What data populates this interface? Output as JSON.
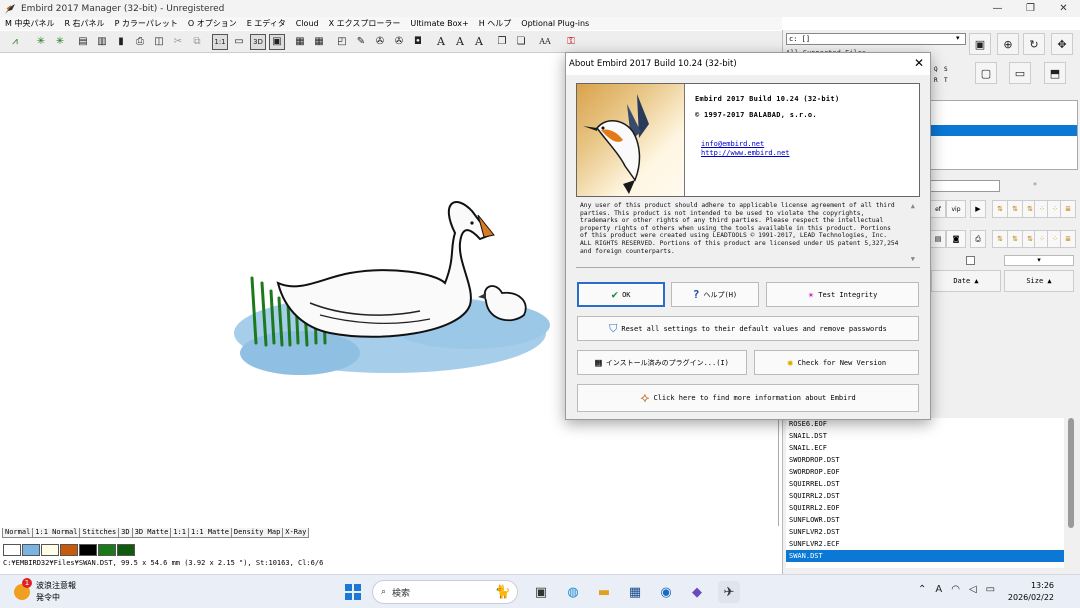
{
  "window": {
    "title": "Embird 2017 Manager (32-bit) - Unregistered",
    "controls": [
      "—",
      "❐",
      "✕"
    ]
  },
  "menu": [
    "M 中央パネル",
    "R 右パネル",
    "P カラーパレット",
    "O オプション",
    "E エディタ",
    "Cloud",
    "X エクスプローラー",
    "Ultimate Box+",
    "H ヘルプ",
    "Optional Plug-ins"
  ],
  "toolbar": {
    "labels": [
      "1:1",
      "3D",
      "A",
      "A",
      "A",
      "AA"
    ]
  },
  "view_tabs": [
    "Normal",
    "1:1 Normal",
    "Stitches",
    "3D",
    "3D Matte",
    "1:1",
    "1:1 Matte",
    "Density Map",
    "X-Ray"
  ],
  "palette_colors": [
    "#ffffff",
    "#7ab4e0",
    "#fffde8",
    "#c85a10",
    "#000000",
    "#1a7a1a",
    "#0f5a0f"
  ],
  "status_line": "C:¥EMBIRD32¥Files¥SWAN.DST, 99.5 x 54.6 mm (3.92 x 2.15 \"), St:10163, Cl:6/6",
  "right_panel": {
    "drive_combo": "c: []",
    "filter_combo": "All Supported Files",
    "col_date": "Date ▲",
    "col_size": "Size ▲",
    "small_labels": [
      "Q",
      "S",
      "R",
      "T",
      "ef",
      "vip"
    ],
    "files": [
      "ROSE6.EOF",
      "SNAIL.DST",
      "SNAIL.ECF",
      "SWORDROP.DST",
      "SWORDROP.EOF",
      "SQUIRREL.DST",
      "SQUIRRL2.DST",
      "SQUIRRL2.EOF",
      "SUNFLOWR.DST",
      "SUNFLVR2.DST",
      "SUNFLVR2.ECF",
      "SWAN.DST"
    ]
  },
  "about": {
    "title": "About Embird 2017 Build 10.24 (32-bit)",
    "product": "Embird 2017 Build 10.24 (32-bit)",
    "copyright": "© 1997-2017 BALABAD, s.r.o.",
    "email": "info@embird.net",
    "website": "http://www.embird.net",
    "license": "Any user of this product should adhere to applicable license agreement of all third parties. This product is not intended to be used to violate the copyrights, trademarks or other rights of any third parties. Please respect the intellectual property rights of others when using the tools available in this product. Portions of this product were created using LEADTOOLS © 1991-2017, LEAD Technologies, Inc. ALL RIGHTS RESERVED. Portions of this product are licensed under US patent 5,327,254 and foreign counterparts.",
    "ok_label": "OK",
    "help_label": "ヘルプ(H)",
    "test_label": "Test Integrity",
    "reset_label": "Reset all settings to their default values and remove passwords",
    "plugins_label": "インストール済みのプラグイン...(I)",
    "check_label": "Check for New Version",
    "more_label": "Click here to find more information about Embird"
  },
  "taskbar": {
    "weather_badge": "1",
    "weather_line1": "波浪注意報",
    "weather_line2": "発令中",
    "search_text": "検索",
    "ime": "A",
    "time": "13:26",
    "date": "2026/02/22"
  }
}
